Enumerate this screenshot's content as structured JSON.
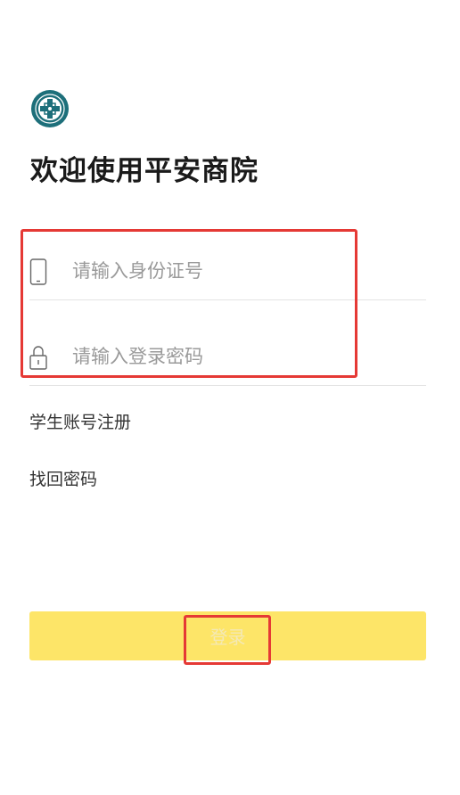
{
  "header": {
    "logo_icon": "school-emblem-icon",
    "title": "欢迎使用平安商院"
  },
  "form": {
    "id_field": {
      "icon": "phone-icon",
      "placeholder": "请输入身份证号",
      "value": ""
    },
    "password_field": {
      "icon": "lock-icon",
      "placeholder": "请输入登录密码",
      "value": ""
    }
  },
  "links": {
    "register": "学生账号注册",
    "forgot_password": "找回密码"
  },
  "login_button": {
    "label": "登录"
  },
  "colors": {
    "button_bg": "#fde568",
    "button_text": "#f4e9b6",
    "highlight": "#e53935",
    "emblem": "#1d6f7a"
  }
}
